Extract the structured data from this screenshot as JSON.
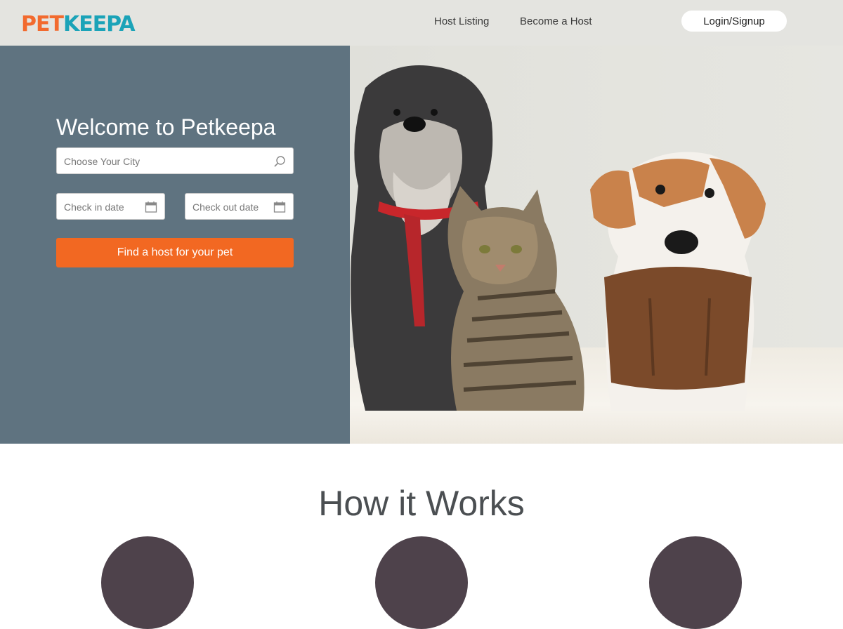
{
  "header": {
    "logo": {
      "part1": "PET",
      "part2": "KEEPA"
    },
    "nav": [
      {
        "label": "Host Listing"
      },
      {
        "label": "Become a Host"
      }
    ],
    "login_label": "Login/Signup"
  },
  "hero": {
    "title": "Welcome to Petkeepa",
    "city_placeholder": "Choose Your City",
    "checkin_placeholder": "Check in date",
    "checkout_placeholder": "Check out date",
    "cta_label": "Find a host for your pet",
    "icons": {
      "city": "search-icon",
      "dates": "calendar-icon"
    }
  },
  "how_it_works": {
    "title": "How it Works"
  },
  "colors": {
    "brand_orange": "#f26822",
    "brand_teal": "#1ba3b8",
    "hero_overlay": "#5f7380",
    "circle": "#4e424b"
  }
}
